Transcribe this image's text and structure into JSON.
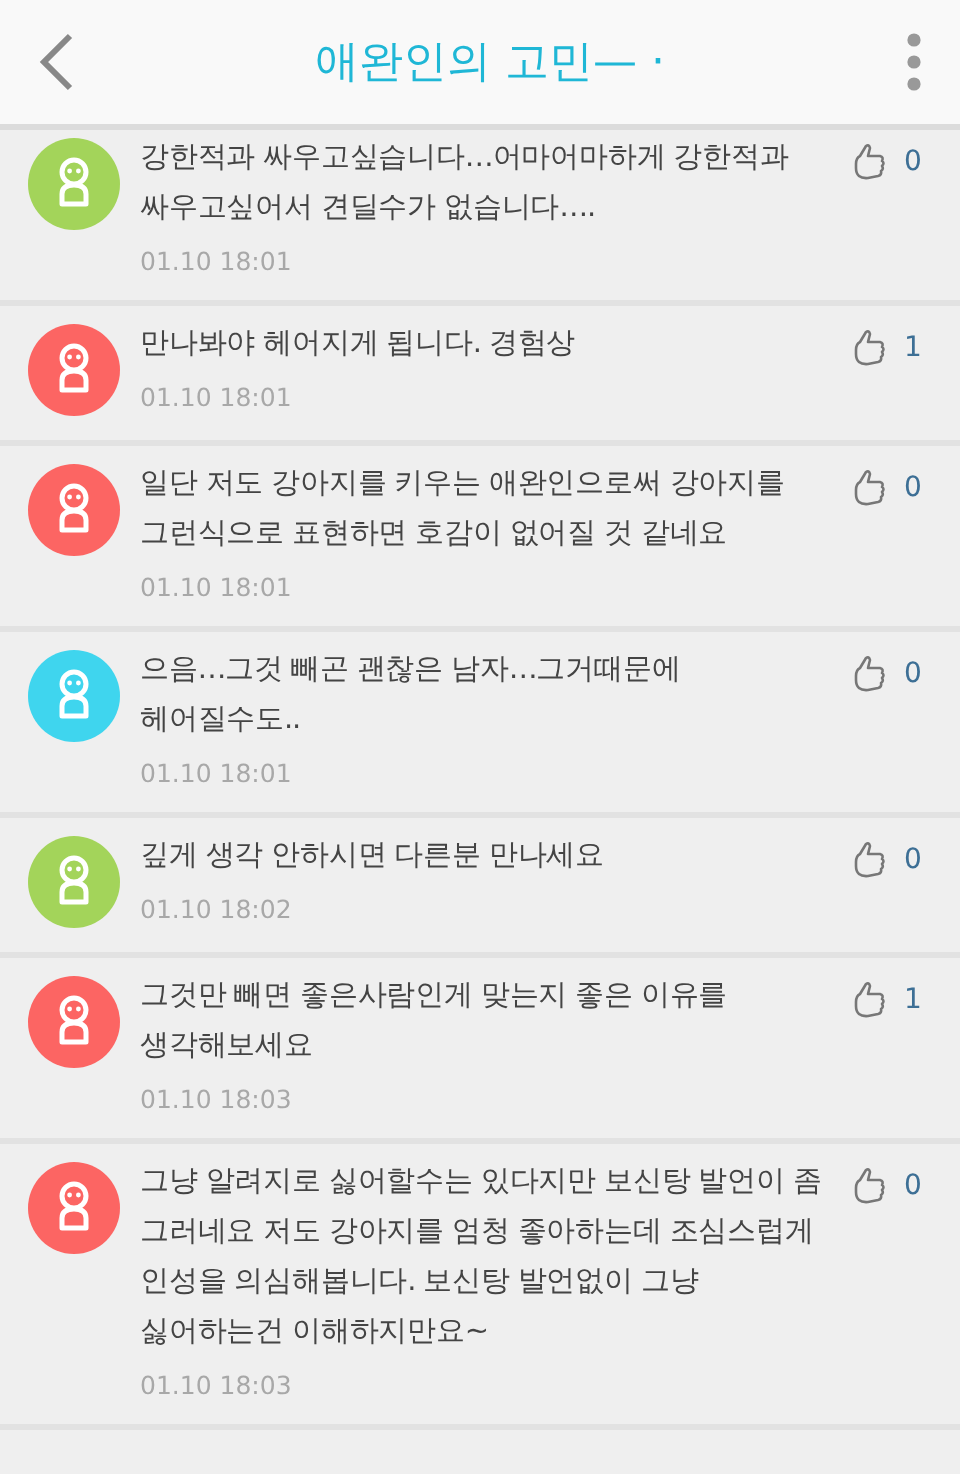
{
  "header": {
    "title": "애완인의 고민— ·"
  },
  "comments": [
    {
      "text": "강한적과 싸우고싶습니다…어마어마하게 강한적과 싸우고싶어서 견딜수가 없습니다….",
      "time": "01.10 18:01",
      "likes": "0",
      "color": "#a3d45a"
    },
    {
      "text": "만나봐야 헤어지게 됩니다. 경험상",
      "time": "01.10 18:01",
      "likes": "1",
      "color": "#fc6563"
    },
    {
      "text": "일단 저도 강아지를 키우는 애완인으로써 강아지를 그런식으로 표현하면 호감이 없어질 것 같네요",
      "time": "01.10 18:01",
      "likes": "0",
      "color": "#fc6563"
    },
    {
      "text": "으음…그것 빼곤 괜찮은 남자…그거때문에 헤어질수도..",
      "time": "01.10 18:01",
      "likes": "0",
      "color": "#3fd5ee"
    },
    {
      "text": "깊게 생각 안하시면 다른분 만나세요",
      "time": "01.10 18:02",
      "likes": "0",
      "color": "#a3d45a"
    },
    {
      "text": "그것만 빼면 좋은사람인게 맞는지 좋은 이유를 생각해보세요",
      "time": "01.10 18:03",
      "likes": "1",
      "color": "#fc6563"
    },
    {
      "text": "그냥 알려지로 싫어할수는 있다지만 보신탕 발언이 좀 그러네요 저도 강아지를 엄청 좋아하는데 조심스럽게 인성을 의심해봅니다. 보신탕 발언없이 그냥 싫어하는건 이해하지만요~",
      "time": "01.10 18:03",
      "likes": "0",
      "color": "#fc6563"
    }
  ]
}
